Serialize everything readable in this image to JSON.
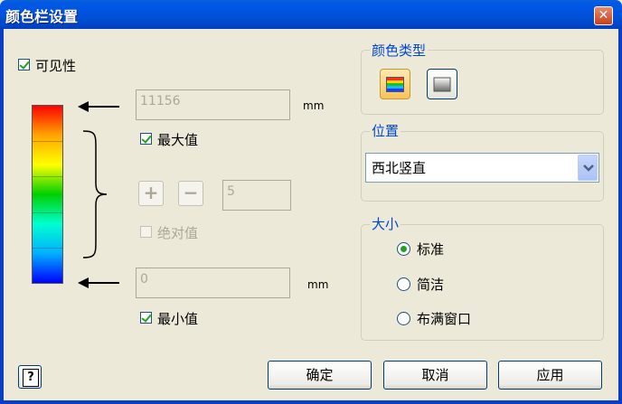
{
  "dialog": {
    "title": "颜色栏设置",
    "close_symbol": "✕"
  },
  "visible": {
    "label": "可见性",
    "checked": true
  },
  "colorbar": {
    "colors": [
      "#ff0000",
      "#ffa500",
      "#ffff00",
      "#00d000",
      "#00ffd0",
      "#00b0ff",
      "#0000ff"
    ]
  },
  "max": {
    "value": "11156",
    "unit": "mm",
    "label": "最大值",
    "checked": true
  },
  "steps": {
    "plus": "+",
    "minus": "−",
    "value": "5"
  },
  "absolute": {
    "label": "绝对值",
    "checked": false,
    "enabled": false
  },
  "min": {
    "value": "0",
    "unit": "mm",
    "label": "最小值",
    "checked": true
  },
  "color_type": {
    "title": "颜色类型",
    "options": [
      "gradient-icon",
      "grayscale-icon"
    ],
    "selected": 0
  },
  "position": {
    "title": "位置",
    "selected": "西北竖直"
  },
  "size": {
    "title": "大小",
    "options": [
      "标准",
      "简洁",
      "布满窗口"
    ],
    "selected": 0
  },
  "buttons": {
    "help": "?",
    "ok": "确定",
    "cancel": "取消",
    "apply": "应用"
  },
  "colors": {
    "title_bar": "#0050d8",
    "group_title": "#0046d5",
    "face": "#ece9d8",
    "check": "#21a121"
  }
}
